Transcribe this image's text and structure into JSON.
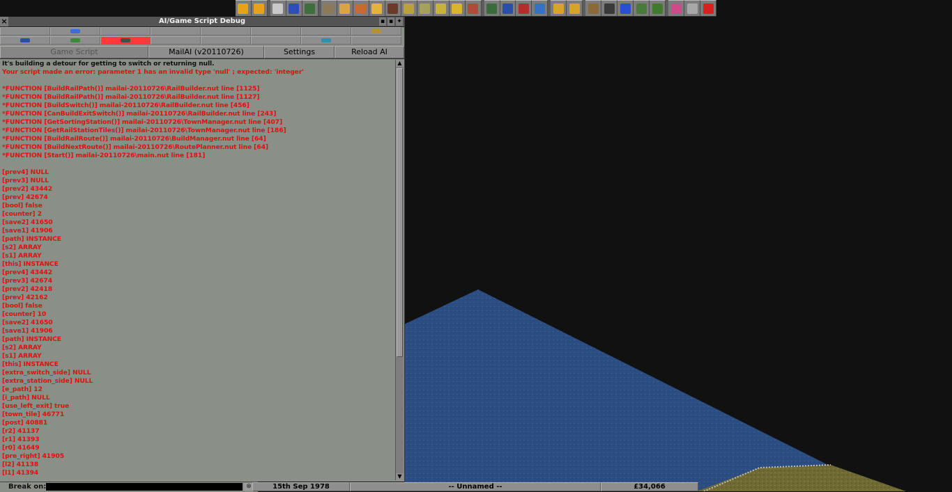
{
  "window": {
    "title": "AI/Game Script Debug",
    "close_glyph": "×"
  },
  "toolbar": {
    "icons": [
      {
        "name": "pause-icon",
        "color": "#e7a21a"
      },
      {
        "name": "fast-forward-icon",
        "color": "#e7a21a"
      },
      {
        "name": "settings-icon",
        "color": "#c9c9c9"
      },
      {
        "name": "save-icon",
        "color": "#2f4fb8"
      },
      {
        "name": "map-icon",
        "color": "#3c6f3c"
      },
      {
        "name": "town-directory-icon",
        "color": "#8a7a5a"
      },
      {
        "name": "subsidies-icon",
        "color": "#d8a640"
      },
      {
        "name": "station-list-icon",
        "color": "#c96a35"
      },
      {
        "name": "finances-icon",
        "color": "#e2b53a"
      },
      {
        "name": "company-icon",
        "color": "#6a3a2a"
      },
      {
        "name": "story-book-icon",
        "color": "#b9a23a"
      },
      {
        "name": "goals-icon",
        "color": "#a6a15a"
      },
      {
        "name": "graphs-icon",
        "color": "#c7b33c"
      },
      {
        "name": "league-table-icon",
        "color": "#d9b52a"
      },
      {
        "name": "industry-icon",
        "color": "#b24a3a"
      },
      {
        "name": "trains-icon",
        "color": "#3b6a3b"
      },
      {
        "name": "road-vehicles-icon",
        "color": "#2a4fa8"
      },
      {
        "name": "ships-icon",
        "color": "#b52c2c"
      },
      {
        "name": "aircraft-icon",
        "color": "#3a6fc8"
      },
      {
        "name": "zoom-in-icon",
        "color": "#d6a42a"
      },
      {
        "name": "zoom-out-icon",
        "color": "#d6a42a"
      },
      {
        "name": "build-rail-icon",
        "color": "#8a6a3a"
      },
      {
        "name": "build-road-icon",
        "color": "#3a3a3a"
      },
      {
        "name": "build-water-icon",
        "color": "#2a4fd0"
      },
      {
        "name": "build-air-icon",
        "color": "#4a7a3a"
      },
      {
        "name": "landscaping-icon",
        "color": "#3f7a2f"
      },
      {
        "name": "music-icon",
        "color": "#d04a8a"
      },
      {
        "name": "newspaper-icon",
        "color": "#a8a8a8"
      },
      {
        "name": "help-icon",
        "color": "#d82020"
      }
    ]
  },
  "companies": {
    "row1": [
      {
        "color": "",
        "selected": false
      },
      {
        "color": "#3a6fd0",
        "selected": false
      },
      {
        "color": "",
        "selected": false
      },
      {
        "color": "",
        "selected": false
      },
      {
        "color": "",
        "selected": false
      },
      {
        "color": "",
        "selected": false
      },
      {
        "color": "",
        "selected": false
      },
      {
        "color": "#b8903a",
        "selected": false
      }
    ],
    "row2": [
      {
        "color": "#2a4fa0",
        "selected": false
      },
      {
        "color": "#3a8a3a",
        "selected": false
      },
      {
        "color": "#4a4a4a",
        "selected": true
      },
      {
        "color": "",
        "selected": false
      },
      {
        "color": "",
        "selected": false
      },
      {
        "color": "",
        "selected": false
      },
      {
        "color": "#3a8ab0",
        "selected": false
      },
      {
        "color": "",
        "selected": false
      }
    ]
  },
  "tabs": [
    {
      "label": "Game Script",
      "disabled": true
    },
    {
      "label": "MailAI (v20110726)",
      "disabled": false
    },
    {
      "label": "Settings",
      "disabled": false
    },
    {
      "label": "Reload AI",
      "disabled": false
    }
  ],
  "log": [
    "It's building a detour for getting to switch or returning null.",
    "Your script made an error: parameter 1 has an invalid type 'null' ; expected: 'integer'",
    "",
    "*FUNCTION [BuildRailPath()] mailai-20110726\\RailBuilder.nut line [1125]",
    "*FUNCTION [BuildRailPath()] mailai-20110726\\RailBuilder.nut line [1127]",
    "*FUNCTION [BuildSwitch()] mailai-20110726\\RailBuilder.nut line [456]",
    "*FUNCTION [CanBuildExitSwitch()] mailai-20110726\\RailBuilder.nut line [243]",
    "*FUNCTION [GetSortingStation()] mailai-20110726\\TownManager.nut line [407]",
    "*FUNCTION [GetRailStationTiles()] mailai-20110726\\TownManager.nut line [186]",
    "*FUNCTION [BuildRailRoute()] mailai-20110726\\BuildManager.nut line [64]",
    "*FUNCTION [BuildNextRoute()] mailai-20110726\\RoutePlanner.nut line [64]",
    "*FUNCTION [Start()] mailai-20110726\\main.nut line [181]",
    "",
    "[prev4] NULL",
    "[prev3] NULL",
    "[prev2] 43442",
    "[prev] 42674",
    "[bool] false",
    "[counter] 2",
    "[save2] 41650",
    "[save1] 41906",
    "[path] INSTANCE",
    "[s2] ARRAY",
    "[s1] ARRAY",
    "[this] INSTANCE",
    "[prev4] 43442",
    "[prev3] 42674",
    "[prev2] 42418",
    "[prev] 42162",
    "[bool] false",
    "[counter] 10",
    "[save2] 41650",
    "[save1] 41906",
    "[path] INSTANCE",
    "[s2] ARRAY",
    "[s1] ARRAY",
    "[this] INSTANCE",
    "[extra_switch_side] NULL",
    "[extra_station_side] NULL",
    "[e_path] 12",
    "[i_path] NULL",
    "[use_left_exit] true",
    "[town_tile] 46771",
    "[post] 40881",
    "[r2] 41137",
    "[r1] 41393",
    "[r0] 41649",
    "[pre_right] 41905",
    "[l2] 41138",
    "[l1] 41394"
  ],
  "break_bar": {
    "label": "Break on:",
    "value": "",
    "clear_glyph": "⊗"
  },
  "status": {
    "date": "15th Sep 1978",
    "company": "-- Unnamed --",
    "money": "£34,066"
  },
  "colors": {
    "water": "#2c4d82",
    "error_text": "#e01010",
    "window_bg": "#8a8f88"
  }
}
